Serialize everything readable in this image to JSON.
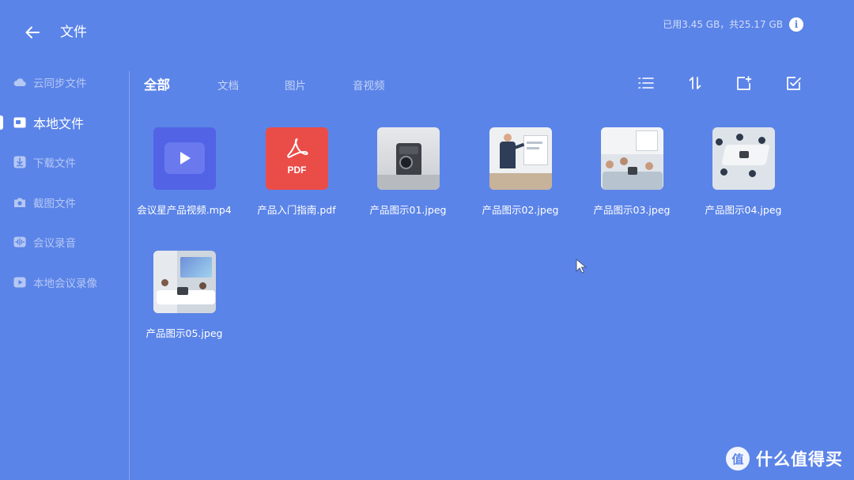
{
  "header": {
    "title": "文件",
    "storage_text": "已用3.45 GB，共25.17 GB",
    "back_icon": "arrow-left-icon",
    "info_icon": "info-icon",
    "info_glyph": "i"
  },
  "sidebar": {
    "items": [
      {
        "label": "云同步文件",
        "icon": "cloud-icon"
      },
      {
        "label": "本地文件",
        "icon": "folder-image-icon",
        "active": true
      },
      {
        "label": "下载文件",
        "icon": "download-icon"
      },
      {
        "label": "截图文件",
        "icon": "camera-icon"
      },
      {
        "label": "会议录音",
        "icon": "audio-wave-icon"
      },
      {
        "label": "本地会议录像",
        "icon": "video-play-icon"
      }
    ]
  },
  "tabs": [
    {
      "label": "全部",
      "active": true
    },
    {
      "label": "文档"
    },
    {
      "label": "图片"
    },
    {
      "label": "音视频"
    }
  ],
  "toolbar": {
    "icons": [
      "list-view-icon",
      "sort-icon",
      "new-folder-icon",
      "multi-select-icon"
    ]
  },
  "files": [
    {
      "name": "会议星产品视频.mp4",
      "type": "video",
      "icon": "play-icon"
    },
    {
      "name": "产品入门指南.pdf",
      "type": "pdf",
      "icon_text": "PDF"
    },
    {
      "name": "产品图示01.jpeg",
      "type": "image"
    },
    {
      "name": "产品图示02.jpeg",
      "type": "image"
    },
    {
      "name": "产品图示03.jpeg",
      "type": "image"
    },
    {
      "name": "产品图示04.jpeg",
      "type": "image"
    },
    {
      "name": "产品图示05.jpeg",
      "type": "image"
    }
  ],
  "watermark": {
    "text": "什么值得买",
    "logo_glyph": "值"
  },
  "colors": {
    "background": "#5b84e8",
    "video_tile": "#5263e6",
    "pdf_tile": "#ea4d48"
  }
}
